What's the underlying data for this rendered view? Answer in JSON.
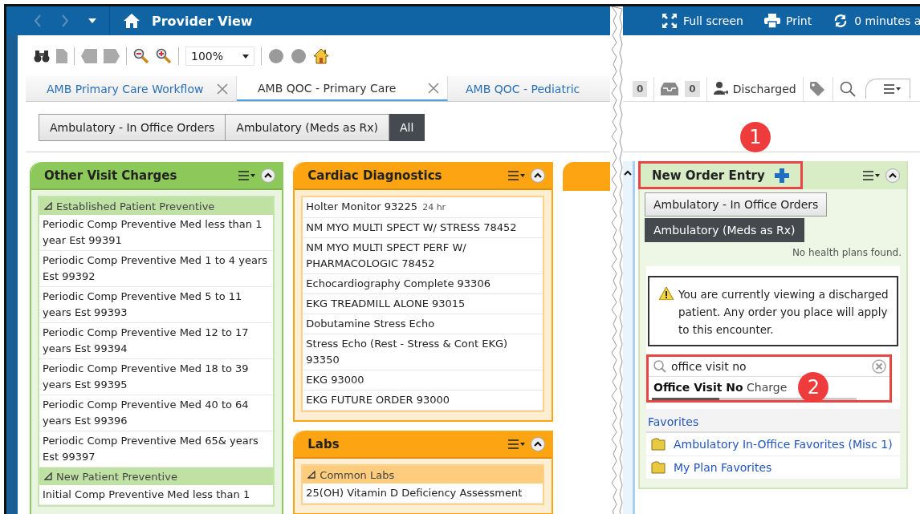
{
  "header": {
    "title": "Provider View",
    "actions": [
      {
        "kind": "fullscreen",
        "label": "Full screen"
      },
      {
        "kind": "print",
        "label": "Print"
      },
      {
        "kind": "refresh",
        "label": "0 minutes a"
      }
    ]
  },
  "toolbar": {
    "zoom": "100%"
  },
  "tabs": [
    {
      "label": "AMB Primary Care Workflow",
      "selected": false,
      "closable": true
    },
    {
      "label": "AMB QOC - Primary Care",
      "selected": true,
      "closable": true
    },
    {
      "label": "AMB QOC - Pediatric",
      "selected": false,
      "closable": false
    }
  ],
  "patient_bar": {
    "count_1": "0",
    "count_2": "0",
    "status": "Discharged"
  },
  "filters": [
    {
      "label": "Ambulatory - In Office Orders",
      "selected": false
    },
    {
      "label": "Ambulatory (Meds as Rx)",
      "selected": false
    },
    {
      "label": "All",
      "selected": true
    }
  ],
  "components": [
    {
      "title": "Other Visit Charges",
      "color": "#8cc85a",
      "groups": [
        {
          "label": "Established Patient Preventive",
          "expanded": true,
          "items": [
            {
              "text": "Periodic Comp Preventive Med less than 1 year Est 99391"
            },
            {
              "text": "Periodic Comp Preventive Med 1 to 4 years Est 99392"
            },
            {
              "text": "Periodic Comp Preventive Med 5 to 11 years Est 99393"
            },
            {
              "text": "Periodic Comp Preventive Med 12 to 17 years Est 99394"
            },
            {
              "text": "Periodic Comp Preventive Med 18 to 39 years Est 99395"
            },
            {
              "text": "Periodic Comp Preventive Med 40 to 64 years Est 99396"
            },
            {
              "text": "Periodic Comp Preventive Med 65& years Est 99397"
            }
          ]
        },
        {
          "label": "New Patient Preventive",
          "expanded": true,
          "items": [
            {
              "text": "Initial Comp Preventive Med less than 1"
            }
          ]
        }
      ]
    },
    {
      "title": "Cardiac Diagnostics",
      "color": "#fca412",
      "items": [
        {
          "text": "Holter Monitor 93225",
          "note": "24 hr"
        },
        {
          "text": "NM MYO MULTI SPECT W/ STRESS 78452"
        },
        {
          "text": "NM MYO MULTI SPECT PERF W/ PHARMACOLOGIC 78452"
        },
        {
          "text": "Echocardiography Complete 93306"
        },
        {
          "text": "EKG TREADMILL ALONE 93015"
        },
        {
          "text": "Dobutamine Stress Echo"
        },
        {
          "text": "Stress Echo (Rest - Stress & Cont EKG) 93350"
        },
        {
          "text": "EKG 93000"
        },
        {
          "text": "EKG FUTURE ORDER 93000"
        }
      ]
    },
    {
      "title": "Labs",
      "color": "#fca412",
      "groups": [
        {
          "label": "Common Labs",
          "expanded": true,
          "items": [
            {
              "text": "25(OH) Vitamin D Deficiency Assessment"
            }
          ]
        }
      ]
    }
  ],
  "order_entry": {
    "title": "New Order Entry",
    "folders": [
      {
        "label": "Ambulatory - In Office Orders",
        "selected": false
      },
      {
        "label": "Ambulatory (Meds as Rx)",
        "selected": true
      }
    ],
    "health_plans": "No health plans found.",
    "warning": "You are currently viewing a discharged patient. Any order you place will apply to this encounter.",
    "search": {
      "value": "office visit no"
    },
    "suggestion": "**Office Visit No** Charge",
    "favorites_label": "Favorites",
    "favorites": [
      "Ambulatory In-Office Favorites (Misc 1)",
      "My Plan Favorites"
    ]
  },
  "callouts": [
    "1",
    "2"
  ]
}
